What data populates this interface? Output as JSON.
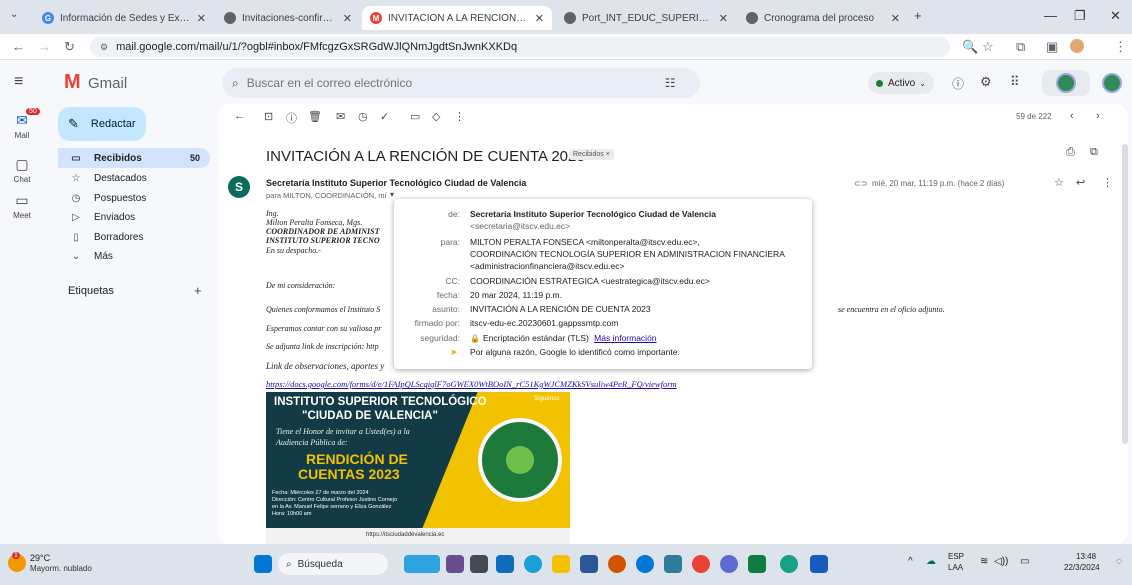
{
  "tabs": [
    {
      "title": "Información de Sedes y Extensi",
      "active": false
    },
    {
      "title": "Invitaciones-confirmacion-y-a",
      "active": false
    },
    {
      "title": "INVITACIÓN A LA RENCIÓN DE",
      "active": true
    },
    {
      "title": "Port_INT_EDUC_SUPERIOR_out",
      "active": false
    },
    {
      "title": "Cronograma del proceso",
      "active": false
    }
  ],
  "address": {
    "url": "mail.google.com/mail/u/1/?ogbl#inbox/FMfcgzGxSRGdWJlQNmJgdtSnJwnKXKDq"
  },
  "gmail": {
    "brand": "Gmail",
    "search_placeholder": "Buscar en el correo electrónico",
    "status": "Activo",
    "compose": "Redactar",
    "rail": {
      "mail": "Mail",
      "chat": "Chat",
      "meet": "Meet",
      "mail_badge": "50"
    },
    "folders": [
      {
        "label": "Recibidos",
        "count": "50",
        "icon": "inbox-icon"
      },
      {
        "label": "Destacados",
        "count": "",
        "icon": "star-icon"
      },
      {
        "label": "Pospuestos",
        "count": "",
        "icon": "clock-icon"
      },
      {
        "label": "Enviados",
        "count": "",
        "icon": "send-icon"
      },
      {
        "label": "Borradores",
        "count": "",
        "icon": "draft-icon"
      },
      {
        "label": "Más",
        "count": "",
        "icon": "chevron-down-icon"
      }
    ],
    "labels_heading": "Etiquetas",
    "pagination": "59 de 222"
  },
  "email": {
    "subject": "INVITACIÓN A LA RENCIÓN DE CUENTA 2023",
    "badge": "Recibidos ×",
    "sender": "Secretaría Instituto Superior Tecnológico Ciudad de Valencia",
    "to_line": "para MILTON, COORDINACIÓN, mí",
    "date": "mié, 20 mar, 11:19 p.m. (hace 2 días)",
    "body": [
      "Ing.",
      "Milton Peralta Fonseca, Mgs.",
      "COORDINADOR DE ADMINIST",
      "INSTITUTO SUPERIOR TECNO",
      "En su despacho.-",
      "De mi consideración:",
      "Quienes conformamos el Instituto S",
      "Esperamos contar con su valiosa pr",
      "Se adjunta link de inscripción: http",
      "Link de observaciones, aportes y"
    ],
    "body_tail": "se encuentra en el oficio adjunto.",
    "link": "https://docs.google.com/forms/d/e/1FAIpQLScqiqlF7oGWEX0WtBOoIN_rC51KgWJCMZKkSVsuliw4PeR_FQ/viewform"
  },
  "popup": {
    "rows": [
      {
        "label": "de:",
        "value": "Secretaría Instituto Superior Tecnológico Ciudad de Valencia",
        "value2": "<secretaria@itscv.edu.ec>"
      },
      {
        "label": "para:",
        "value": "MILTON PERALTA FONSECA <miltonperalta@itscv.edu.ec>,",
        "value2": "COORDINACIÓN TECNOLOGÍA SUPERIOR EN ADMINISTRACION FINANCIERA",
        "value3": "<administracionfinanciera@itscv.edu.ec>"
      },
      {
        "label": "CC:",
        "value": "COORDINACIÓN ESTRATEGICA <uestrategica@itscv.edu.ec>"
      },
      {
        "label": "fecha:",
        "value": "20 mar 2024, 11:19 p.m."
      },
      {
        "label": "asunto:",
        "value": "INVITACIÓN A LA RENCIÓN DE CUENTA 2023"
      },
      {
        "label": "firmado por:",
        "value": "itscv-edu-ec.20230601.gappssmtp.com"
      },
      {
        "label": "seguridad:",
        "value": "Encriptación estándar (TLS)",
        "link": "Más información"
      },
      {
        "label": "",
        "value": "Por alguna razón, Google lo identificó como importante."
      }
    ]
  },
  "poster": {
    "title1": "INSTITUTO SUPERIOR TECNOLÓGICO",
    "title2": "\"CIUDAD DE VALENCIA\"",
    "invite1": "Tiene el Honor de invitar a Usted(es) a la",
    "invite2": "Audiencia Pública de:",
    "main1": "RENDICIÓN DE",
    "main2": "CUENTAS 2023",
    "details": [
      "Fecha: Miércoles 27 de marzo del 2024",
      "Dirección: Centro Cultural Profesor Justino Cornejo",
      "en la Av. Manuel Felipe serrano y Eliza González",
      "Hora: 10h00 am"
    ],
    "follow": "Síguenos",
    "site": "https://itsciudaddevalencia.ec"
  },
  "taskbar": {
    "temp": "29°C",
    "weather": "Mayorm. nublado",
    "weather_badge": "1",
    "search": "Búsqueda",
    "lang1": "ESP",
    "lang2": "LAA",
    "time": "13:48",
    "date": "22/3/2024"
  }
}
